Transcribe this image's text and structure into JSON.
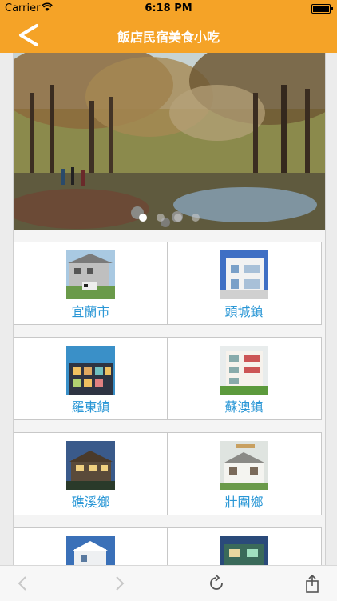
{
  "status_bar": {
    "carrier": "Carrier",
    "time": "6:18 PM"
  },
  "nav": {
    "title": "飯店民宿美食小吃"
  },
  "banner": {
    "image": "forest-park-photo",
    "page_count": 4,
    "active_page": 0
  },
  "towns": [
    {
      "label": "宜蘭市",
      "thumb": "house-photo"
    },
    {
      "label": "頭城鎮",
      "thumb": "white-building-photo"
    },
    {
      "label": "羅東鎮",
      "thumb": "lit-building-photo"
    },
    {
      "label": "蘇澳鎮",
      "thumb": "apartment-photo"
    },
    {
      "label": "礁溪鄉",
      "thumb": "villa-night-photo"
    },
    {
      "label": "壯圍鄉",
      "thumb": "inn-photo"
    },
    {
      "label": "",
      "thumb": "house-photo"
    },
    {
      "label": "",
      "thumb": "building-photo"
    }
  ],
  "colors": {
    "accent": "#f5a327",
    "link": "#2a97d6"
  }
}
